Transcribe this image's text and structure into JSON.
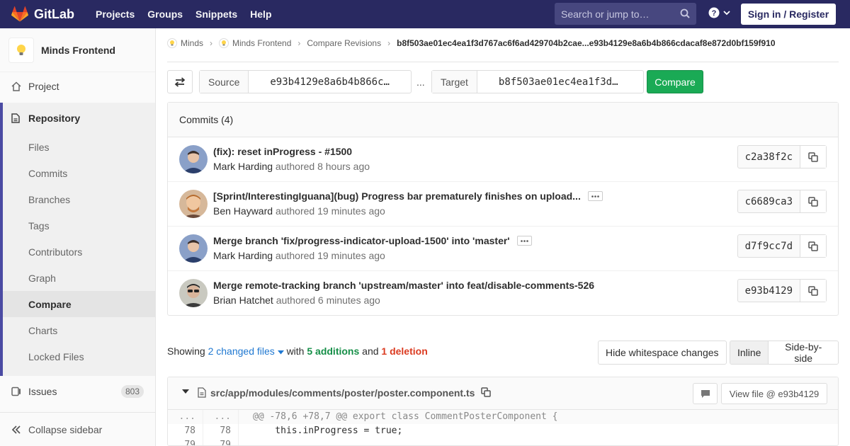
{
  "navbar": {
    "brand": "GitLab",
    "links": [
      "Projects",
      "Groups",
      "Snippets",
      "Help"
    ],
    "search_placeholder": "Search or jump to…",
    "signin_label": "Sign in / Register"
  },
  "sidebar": {
    "project_name": "Minds Frontend",
    "project_label": "Project",
    "repository_label": "Repository",
    "repo_items": [
      "Files",
      "Commits",
      "Branches",
      "Tags",
      "Contributors",
      "Graph",
      "Compare",
      "Charts",
      "Locked Files"
    ],
    "active_item": "Compare",
    "issues_label": "Issues",
    "issues_count": "803",
    "collapse_label": "Collapse sidebar"
  },
  "breadcrumb": {
    "items": [
      "Minds",
      "Minds Frontend",
      "Compare Revisions"
    ],
    "current": "b8f503ae01ec4ea1f3d767ac6f6ad429704b2cae...e93b4129e8a6b4b866cdacaf8e872d0bf159f910"
  },
  "compare": {
    "source_label": "Source",
    "source_value": "e93b4129e8a6b4b866c…",
    "dots": "...",
    "target_label": "Target",
    "target_value": "b8f503ae01ec4ea1f3d…",
    "compare_label": "Compare"
  },
  "commits": {
    "header": "Commits (4)",
    "items": [
      {
        "title": "(fix): reset inProgress - #1500",
        "author": "Mark Harding",
        "verb": "authored",
        "time": "8 hours ago",
        "sha": "c2a38f2c",
        "has_more": false
      },
      {
        "title": "[Sprint/InterestingIguana](bug) Progress bar prematurely finishes on upload...",
        "author": "Ben Hayward",
        "verb": "authored",
        "time": "19 minutes ago",
        "sha": "c6689ca3",
        "has_more": true
      },
      {
        "title": "Merge branch 'fix/progress-indicator-upload-1500' into 'master'",
        "author": "Mark Harding",
        "verb": "authored",
        "time": "19 minutes ago",
        "sha": "d7f9cc7d",
        "has_more": true
      },
      {
        "title": "Merge remote-tracking branch 'upstream/master' into feat/disable-comments-526",
        "author": "Brian Hatchet",
        "verb": "authored",
        "time": "6 minutes ago",
        "sha": "e93b4129",
        "has_more": false
      }
    ]
  },
  "stats": {
    "showing": "Showing",
    "files": "2 changed files",
    "with": "with",
    "additions": "5 additions",
    "and": "and",
    "deletions": "1 deletion",
    "whitespace_label": "Hide whitespace changes",
    "inline_label": "Inline",
    "side_by_side_label": "Side-by-side"
  },
  "file": {
    "path": "src/app/modules/comments/poster/poster.component.ts",
    "view_file_label": "View file @ e93b4129",
    "lines": [
      {
        "a": "...",
        "b": "...",
        "code": "@@ -78,6 +78,7 @@ export class CommentPosterComponent {",
        "hunk": true
      },
      {
        "a": "78",
        "b": "78",
        "code": "    this.inProgress = true;",
        "hunk": false
      },
      {
        "a": "79",
        "b": "79",
        "code": "",
        "hunk": false
      }
    ]
  },
  "colors": {
    "navbar": "#292961",
    "accent": "#4b4ba3",
    "green": "#1aaa55",
    "link": "#1f78d1",
    "deletion": "#db3b21"
  }
}
